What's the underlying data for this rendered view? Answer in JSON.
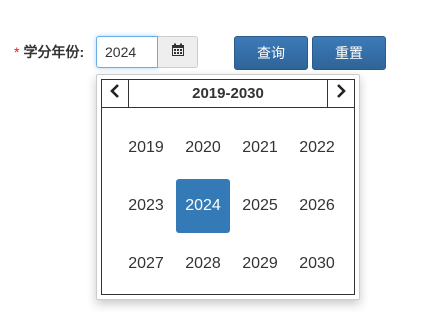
{
  "form": {
    "required_mark": "*",
    "label": "学分年份:",
    "year_value": "2024",
    "query_label": "查询",
    "reset_label": "重置"
  },
  "icons": {
    "calendar": "calendar-icon",
    "prev": "chevron-left-icon",
    "next": "chevron-right-icon"
  },
  "colors": {
    "primary": "#337ab7",
    "button": "#2e6599",
    "required": "#e02020",
    "focus": "#66afe9"
  },
  "picker": {
    "range_title": "2019-2030",
    "selected": "2024",
    "years": [
      "2019",
      "2020",
      "2021",
      "2022",
      "2023",
      "2024",
      "2025",
      "2026",
      "2027",
      "2028",
      "2029",
      "2030"
    ]
  }
}
